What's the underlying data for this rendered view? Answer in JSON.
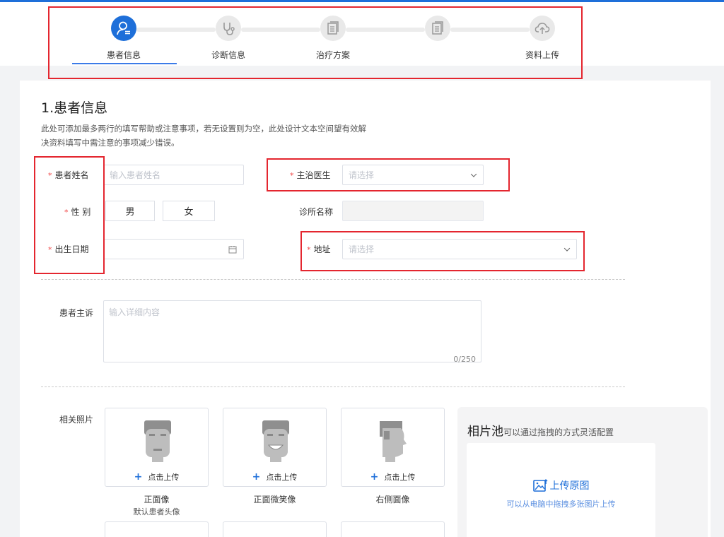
{
  "steps": [
    {
      "label": "患者信息",
      "icon": "user-icon",
      "active": true
    },
    {
      "label": "诊断信息",
      "icon": "stethoscope-icon",
      "active": false
    },
    {
      "label": "治疗方案",
      "icon": "document-icon",
      "active": false
    },
    {
      "label": "",
      "icon": "document-icon",
      "active": false
    },
    {
      "label": "资料上传",
      "icon": "cloud-upload-icon",
      "active": false
    }
  ],
  "section": {
    "title": "1.患者信息",
    "desc": "此处可添加最多两行的填写帮助或注意事项，若无设置则为空，此处设计文本空间望有效解决资料填写中需注意的事项减少错误。"
  },
  "form": {
    "name_label": "患者姓名",
    "name_placeholder": "输入患者姓名",
    "gender_label": "性 别",
    "gender_male": "男",
    "gender_female": "女",
    "birth_label": "出生日期",
    "doctor_label": "主治医生",
    "doctor_placeholder": "请选择",
    "clinic_label": "诊所名称",
    "address_label": "地址",
    "address_placeholder": "请选择",
    "complaint_label": "患者主诉",
    "complaint_placeholder": "输入详细内容",
    "complaint_counter": "0/250"
  },
  "photos": {
    "label": "相关照片",
    "upload_label": "点击上传",
    "items": [
      {
        "caption": "正面像",
        "sub": "默认患者头像"
      },
      {
        "caption": "正面微笑像",
        "sub": ""
      },
      {
        "caption": "右侧面像",
        "sub": ""
      }
    ]
  },
  "pool": {
    "title": "相片池",
    "subtitle": "可以通过拖拽的方式灵活配置",
    "upload_label": "上传原图",
    "hint": "可以从电脑中拖拽多张图片上传"
  },
  "colors": {
    "accent": "#1e6fd9",
    "required": "#f04a4a",
    "highlight": "#e4262f"
  }
}
